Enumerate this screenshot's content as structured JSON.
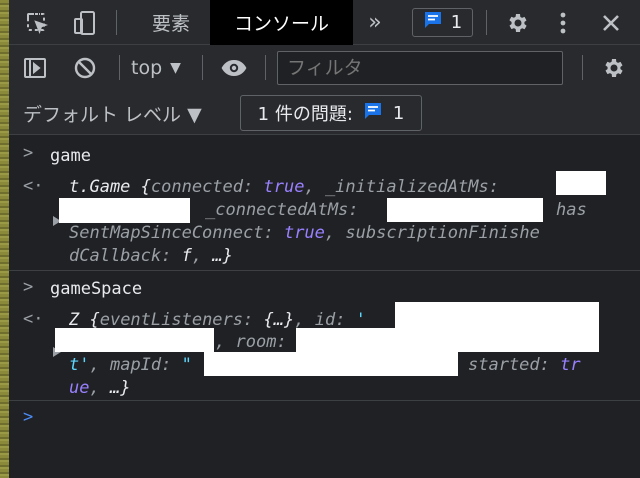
{
  "tabs": {
    "elements": "要素",
    "console": "コンソール",
    "more": "»",
    "messages_count": "1"
  },
  "toolbar": {
    "context": "top",
    "filter_placeholder": "フィルタ",
    "levels": "デフォルト レベル ▼",
    "issues_label": "1 件の問題:",
    "issues_count": "1"
  },
  "console": {
    "entries": [
      {
        "input": "game",
        "output": {
          "line1_prefix": "t.Game {",
          "line1_key1": "connected",
          "line1_val1": "true",
          "line1_key2": "_initializedAtMs",
          "line2_key": "_connectedAtMs",
          "line2_tail": "has",
          "line3_key": "SentMapSinceConnect",
          "line3_val": "true",
          "line3_key2": "subscriptionFinishe",
          "line4_key": "dCallback",
          "line4_val": "f",
          "line4_tail": "…}"
        }
      },
      {
        "input": "gameSpace",
        "output": {
          "line1_prefix": "Z {",
          "line1_key1": "eventListeners",
          "line1_val1": "{…}",
          "line1_key2": "id",
          "line1_str": "'",
          "line2_key": "room",
          "line3_str": "t'",
          "line3_key": "mapId",
          "line3_str2": "\"",
          "line3_key2": "started",
          "line3_val2": "tr",
          "line4_val": "ue",
          "line4_tail": "…}"
        }
      }
    ]
  },
  "colors": {
    "background": "#202124",
    "toolbar": "#292a2d",
    "keyword": "#9980ff",
    "string": "#5cd5fb",
    "accent": "#1a73e8"
  }
}
